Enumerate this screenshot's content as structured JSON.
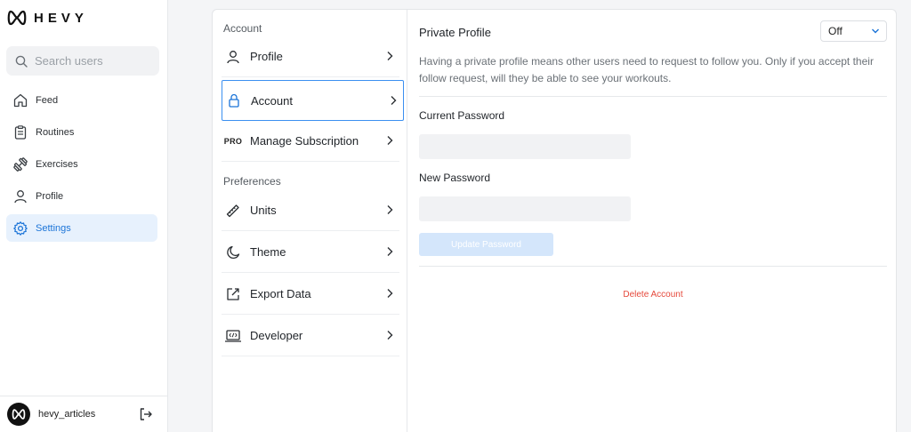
{
  "app": {
    "logo_text": "HEVY"
  },
  "search": {
    "placeholder": "Search users"
  },
  "sidebar": {
    "items": [
      {
        "label": "Feed",
        "icon": "home-icon"
      },
      {
        "label": "Routines",
        "icon": "clipboard-icon"
      },
      {
        "label": "Exercises",
        "icon": "dumbbell-icon"
      },
      {
        "label": "Profile",
        "icon": "user-icon"
      },
      {
        "label": "Settings",
        "icon": "gear-icon",
        "active": true
      }
    ]
  },
  "user": {
    "name": "hevy_articles"
  },
  "settings_menu": {
    "account_group": "Account",
    "preferences_group": "Preferences",
    "items": [
      {
        "label": "Profile",
        "icon": "user-icon"
      },
      {
        "label": "Account",
        "icon": "lock-icon",
        "selected": true
      },
      {
        "label": "Manage Subscription",
        "badge": "PRO"
      },
      {
        "label": "Units",
        "icon": "ruler-icon"
      },
      {
        "label": "Theme",
        "icon": "moon-icon"
      },
      {
        "label": "Export Data",
        "icon": "export-icon"
      },
      {
        "label": "Developer",
        "icon": "code-icon"
      }
    ]
  },
  "account": {
    "private_profile_label": "Private Profile",
    "private_profile_value": "Off",
    "private_profile_description": "Having a private profile means other users need to request to follow you. Only if you accept their follow request, will they be able to see your workouts.",
    "current_password_label": "Current Password",
    "new_password_label": "New Password",
    "update_password_label": "Update Password",
    "delete_account_label": "Delete Account"
  },
  "colors": {
    "accent": "#1b74d8",
    "active_bg": "#e7f1fd",
    "danger": "#e5483b",
    "disabled_button": "#d4e6fb"
  }
}
